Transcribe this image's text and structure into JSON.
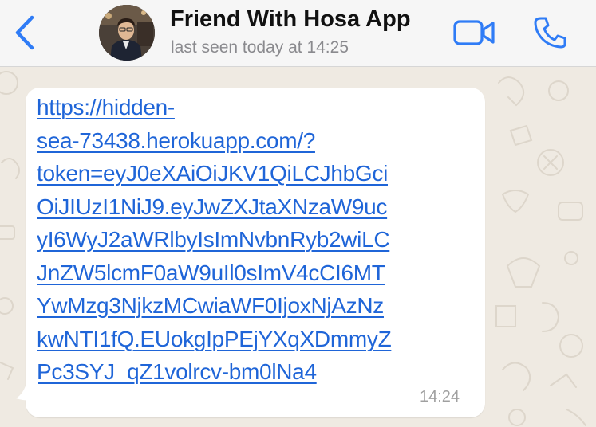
{
  "header": {
    "contact_name": "Friend With Hosa App",
    "last_seen": "last seen today at 14:25",
    "back_icon": "chevron-left-icon",
    "video_icon": "video-camera-icon",
    "call_icon": "phone-icon",
    "accent_color": "#2f7cf6"
  },
  "message": {
    "link_lines": [
      "https://hidden-",
      "sea-73438.herokuapp.com/?",
      "token=eyJ0eXAiOiJKV1QiLCJhbGci",
      "OiJIUzI1NiJ9.eyJwZXJtaXNzaW9uc",
      "yI6WyJ2aWRlbyIsImNvbnRyb2wiLC",
      "JnZW5lcmF0aW9uIl0sImV4cCI6MT",
      "YwMzg3NjkzMCwiaWF0IjoxNjAzNz",
      "kwNTI1fQ.EUokgIpPEjYXqXDmmyZ",
      "Pc3SYJ_qZ1volrcv-bm0lNa4"
    ],
    "time": "14:24",
    "link_color": "#1f65d8"
  }
}
